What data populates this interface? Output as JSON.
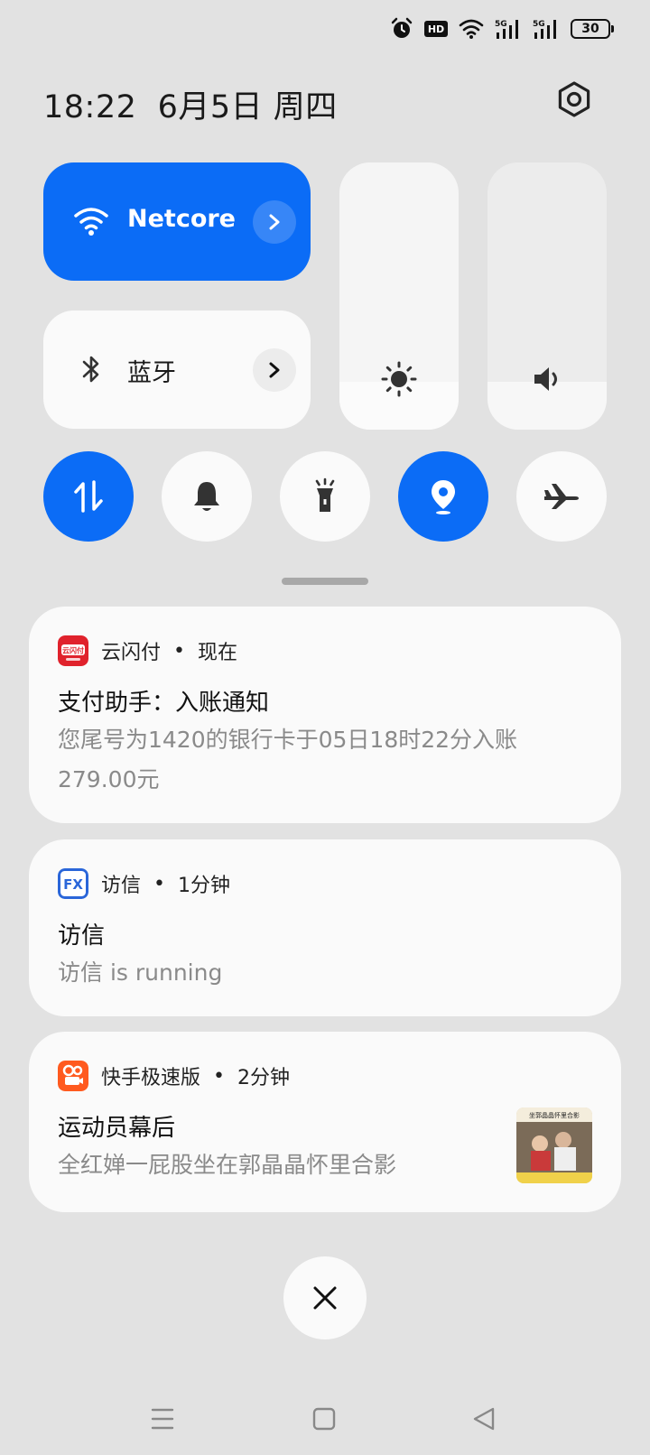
{
  "status_bar": {
    "icons": [
      "alarm-icon",
      "hd-voice-icon",
      "wifi-icon",
      "signal-5g-icon",
      "signal-5g-icon"
    ],
    "hd_label": "HD",
    "signal_label": "5G",
    "battery_level": "30"
  },
  "header": {
    "time": "18:22",
    "date": "6月5日 周四"
  },
  "tiles": {
    "wifi": {
      "label": "Netcore",
      "active": true
    },
    "bluetooth": {
      "label": "蓝牙",
      "active": false
    },
    "brightness": {
      "level": 0.18
    },
    "volume": {
      "level": 0.18
    }
  },
  "toggles": [
    {
      "name": "mobile-data",
      "active": true
    },
    {
      "name": "silent-mode",
      "active": false
    },
    {
      "name": "flashlight",
      "active": false
    },
    {
      "name": "location",
      "active": true
    },
    {
      "name": "airplane-mode",
      "active": false
    }
  ],
  "notifications": [
    {
      "app": "云闪付",
      "time": "现在",
      "title": "支付助手：入账通知",
      "body": "您尾号为1420的银行卡于05日18时22分入账279.00元",
      "icon_text": "云闪付",
      "icon_color": "#e0222c"
    },
    {
      "app": "访信",
      "time": "1分钟",
      "title": "访信",
      "body": "访信 is running",
      "icon_text": "FX",
      "icon_color": "#2a66d9"
    },
    {
      "app": "快手极速版",
      "time": "2分钟",
      "title": "运动员幕后",
      "body": "全红婵一屁股坐在郭晶晶怀里合影",
      "icon_color": "#ff5a1f",
      "thumb_caption": "坐郭晶晶怀里合影"
    }
  ],
  "separator": " • ",
  "colors": {
    "accent": "#0b6cf6",
    "panel_bg": "#e2e2e2",
    "card_bg": "#fafafa"
  }
}
